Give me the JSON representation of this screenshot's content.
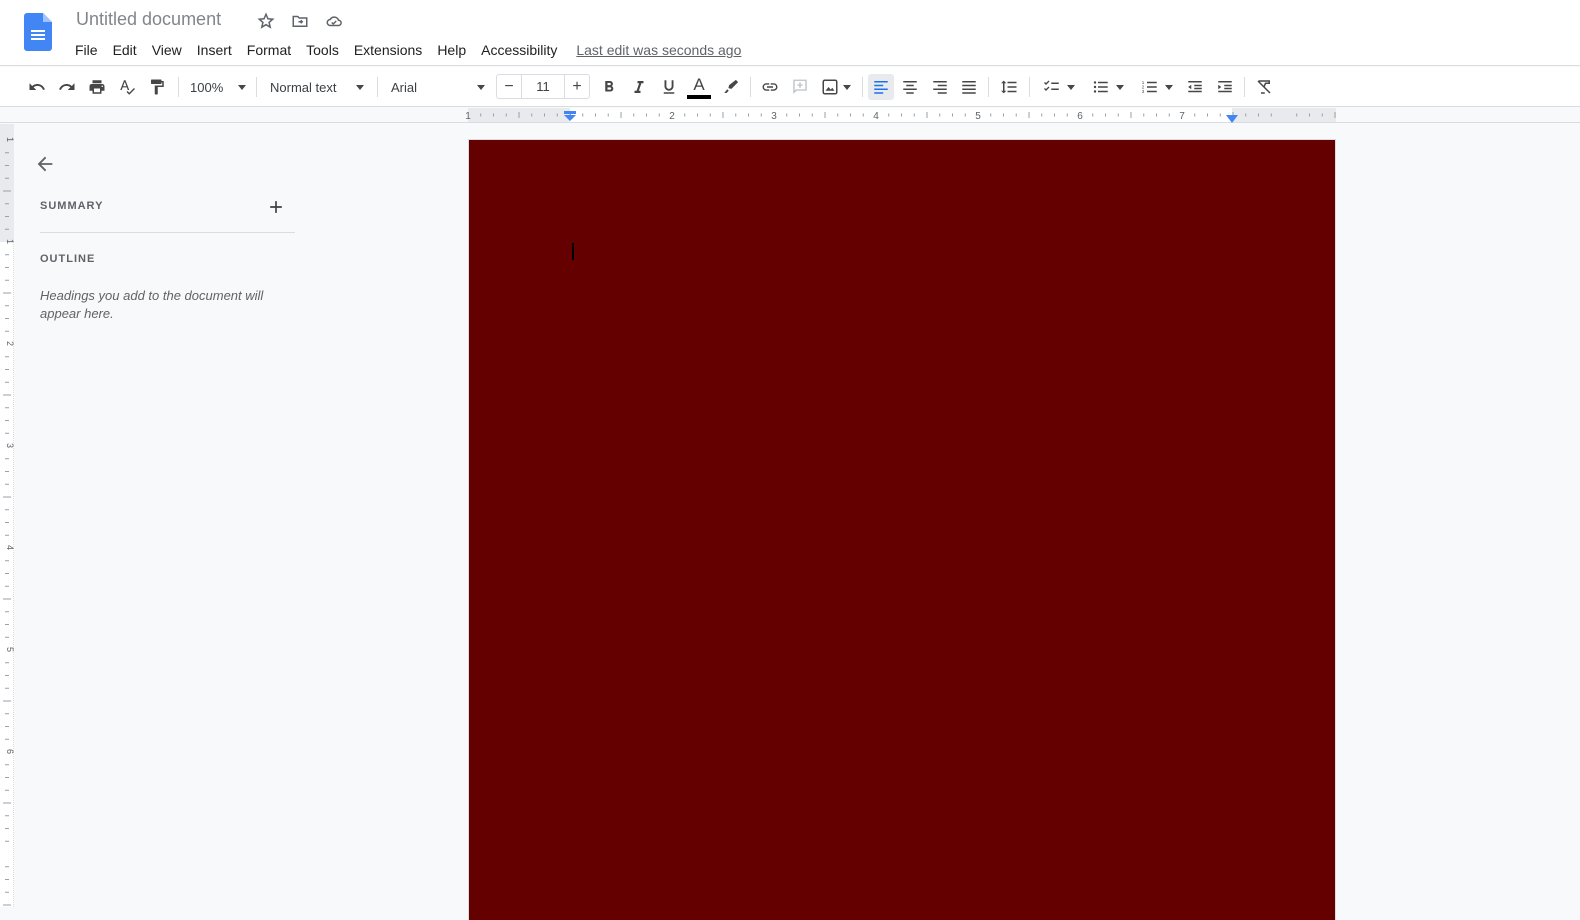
{
  "app": {
    "title": "Untitled document",
    "title_icons": [
      "star-icon",
      "move-to-folder-icon",
      "cloud-saved-icon"
    ],
    "accent_color": "#4285f4"
  },
  "menu": {
    "items": [
      "File",
      "Edit",
      "View",
      "Insert",
      "Format",
      "Tools",
      "Extensions",
      "Help",
      "Accessibility"
    ],
    "last_edit": "Last edit was seconds ago"
  },
  "toolbar": {
    "zoom": "100%",
    "style": "Normal text",
    "font": "Arial",
    "font_size": "11",
    "minus": "−",
    "plus": "+",
    "text_color": "#000000",
    "buttons": [
      "undo",
      "redo",
      "print",
      "spellcheck",
      "paint-format",
      "bold",
      "italic",
      "underline",
      "text-color",
      "highlight",
      "link",
      "comment",
      "image",
      "align-left",
      "align-center",
      "align-right",
      "justify",
      "line-spacing",
      "checklist",
      "bulleted-list",
      "numbered-list",
      "decrease-indent",
      "increase-indent",
      "clear-formatting"
    ],
    "active_alignment": "align-left"
  },
  "ruler": {
    "h_labels": [
      "1",
      "1",
      "2",
      "3",
      "4",
      "5",
      "6",
      "7"
    ],
    "v_labels": [
      "1",
      "1",
      "2",
      "3",
      "4",
      "5",
      "6"
    ]
  },
  "outline_panel": {
    "summary_label": "SUMMARY",
    "outline_label": "OUTLINE",
    "hint": "Headings you add to the document will appear here."
  },
  "document": {
    "background_color": "#640000",
    "text": ""
  }
}
